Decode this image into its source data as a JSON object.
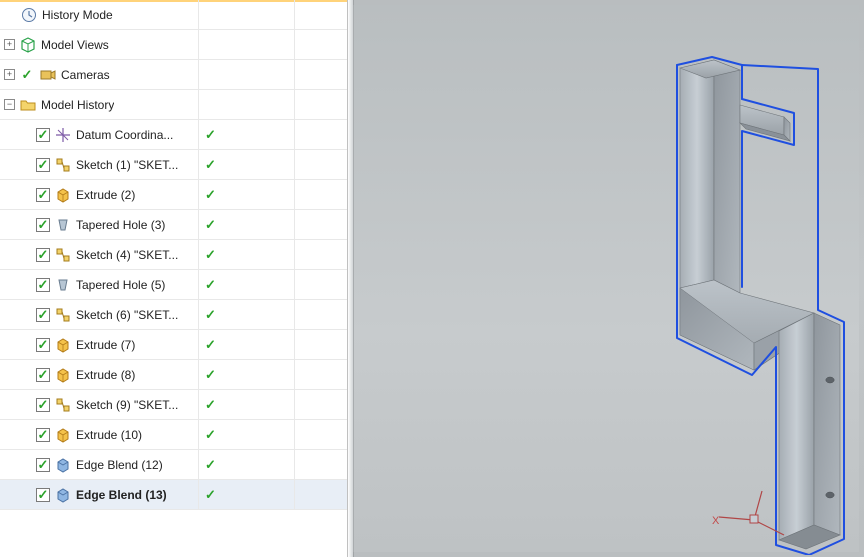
{
  "tree": {
    "history_mode": "History Mode",
    "model_views": "Model Views",
    "cameras": "Cameras",
    "model_history": "Model History",
    "features": [
      {
        "label": "Datum Coordina...",
        "icon": "datum"
      },
      {
        "label": "Sketch (1) \"SKET...",
        "icon": "sketch"
      },
      {
        "label": "Extrude (2)",
        "icon": "extrude"
      },
      {
        "label": "Tapered Hole (3)",
        "icon": "hole"
      },
      {
        "label": "Sketch (4) \"SKET...",
        "icon": "sketch"
      },
      {
        "label": "Tapered Hole (5)",
        "icon": "hole"
      },
      {
        "label": "Sketch (6) \"SKET...",
        "icon": "sketch"
      },
      {
        "label": "Extrude (7)",
        "icon": "extrude"
      },
      {
        "label": "Extrude (8)",
        "icon": "extrude"
      },
      {
        "label": "Sketch (9) \"SKET...",
        "icon": "sketch"
      },
      {
        "label": "Extrude (10)",
        "icon": "extrude"
      },
      {
        "label": "Edge Blend (12)",
        "icon": "blend"
      },
      {
        "label": "Edge Blend (13)",
        "icon": "blend",
        "bold": true,
        "selected": true
      }
    ]
  },
  "axis_x": "X"
}
